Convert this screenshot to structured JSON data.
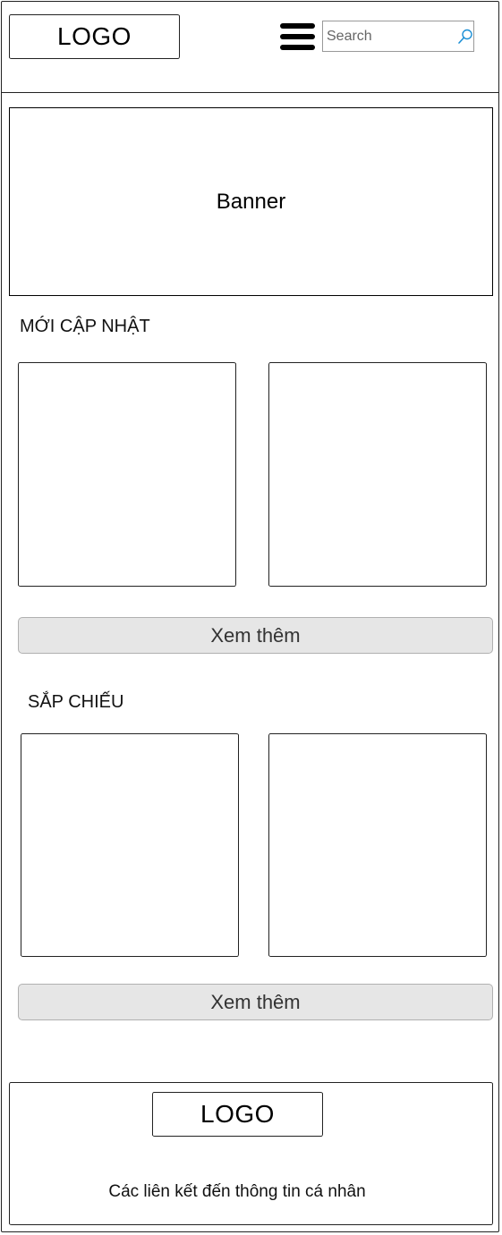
{
  "header": {
    "logo_text": "LOGO",
    "menu_icon": "hamburger-menu-icon",
    "search": {
      "placeholder": "Search",
      "value": "",
      "icon": "search-icon",
      "icon_color": "#1a8fd6"
    }
  },
  "banner": {
    "label": "Banner"
  },
  "sections": [
    {
      "title": "MỚI CẬP NHẬT",
      "more_label": "Xem thêm"
    },
    {
      "title": "SẮP CHIẾU",
      "more_label": "Xem thêm"
    }
  ],
  "footer": {
    "logo_text": "LOGO",
    "links_text": "Các liên kết đến thông tin cá nhân"
  },
  "colors": {
    "button_bg": "#e6e6e6",
    "button_border": "#b0b0b0",
    "stroke": "#222222"
  }
}
